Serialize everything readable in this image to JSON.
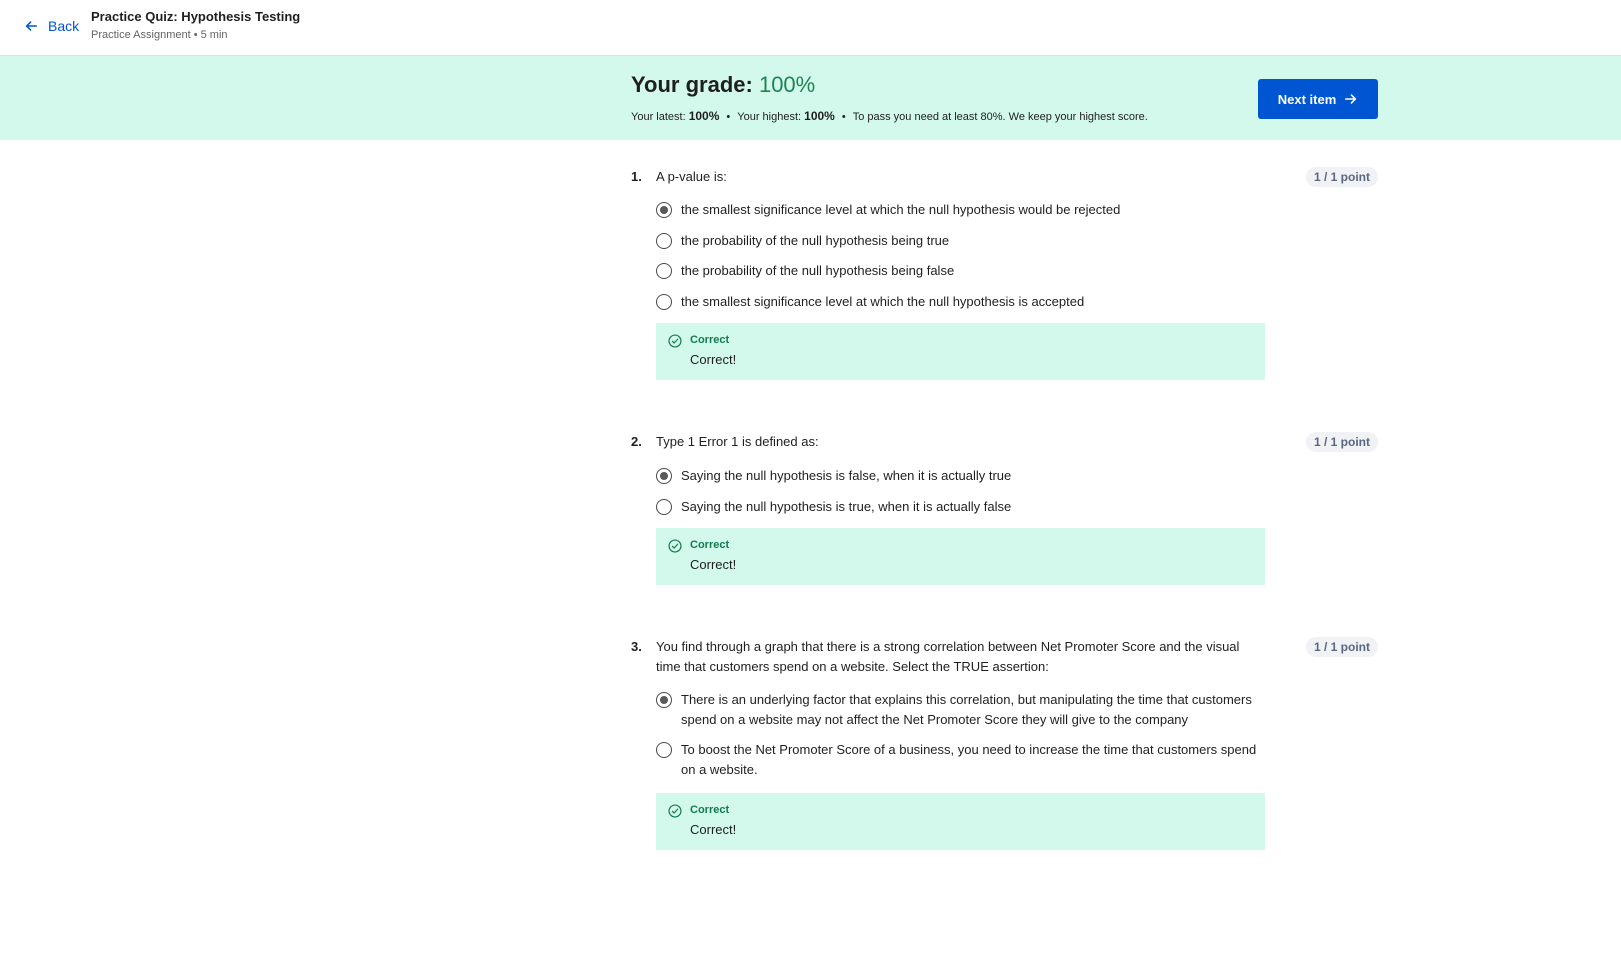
{
  "header": {
    "back_label": "Back",
    "title": "Practice Quiz: Hypothesis Testing",
    "subtitle": "Practice Assignment • 5 min"
  },
  "grade": {
    "label": "Your grade: ",
    "value": "100%",
    "latest_label": "Your latest:",
    "latest_value": "100%",
    "highest_label": "Your highest:",
    "highest_value": "100%",
    "pass_note": "To pass you need at least 80%. We keep your highest score.",
    "separator": "•",
    "next_button": "Next item",
    "accent_color": "#0056d2",
    "banner_color": "#d2f9ec"
  },
  "questions": [
    {
      "number": "1.",
      "text": "A p-value is:",
      "points": "1 / 1 point",
      "options": [
        {
          "label": "the smallest significance level at which the null hypothesis would be rejected",
          "selected": true
        },
        {
          "label": "the probability of the null hypothesis being true",
          "selected": false
        },
        {
          "label": "the probability of the null hypothesis being false",
          "selected": false
        },
        {
          "label": "the smallest significance level at which the null hypothesis is accepted",
          "selected": false
        }
      ],
      "feedback": {
        "title": "Correct",
        "text": "Correct!"
      }
    },
    {
      "number": "2.",
      "text": "Type 1 Error 1 is defined as:",
      "points": "1 / 1 point",
      "options": [
        {
          "label": "Saying the null hypothesis is false, when it is actually true",
          "selected": true
        },
        {
          "label": "Saying the null hypothesis is true, when it is actually false",
          "selected": false
        }
      ],
      "feedback": {
        "title": "Correct",
        "text": "Correct!"
      }
    },
    {
      "number": "3.",
      "text": "You find through a graph that there is a strong correlation between Net Promoter Score and the visual time that customers spend on a website. Select the TRUE assertion:",
      "points": "1 / 1 point",
      "options": [
        {
          "label": "There is an underlying factor that explains this correlation, but manipulating the time that customers spend on a website may not affect the Net Promoter Score they will give to the company",
          "selected": true
        },
        {
          "label": "To boost the Net Promoter Score of a business, you need to increase the time that customers spend on a website.",
          "selected": false
        }
      ],
      "feedback": {
        "title": "Correct",
        "text": "Correct!"
      }
    }
  ]
}
